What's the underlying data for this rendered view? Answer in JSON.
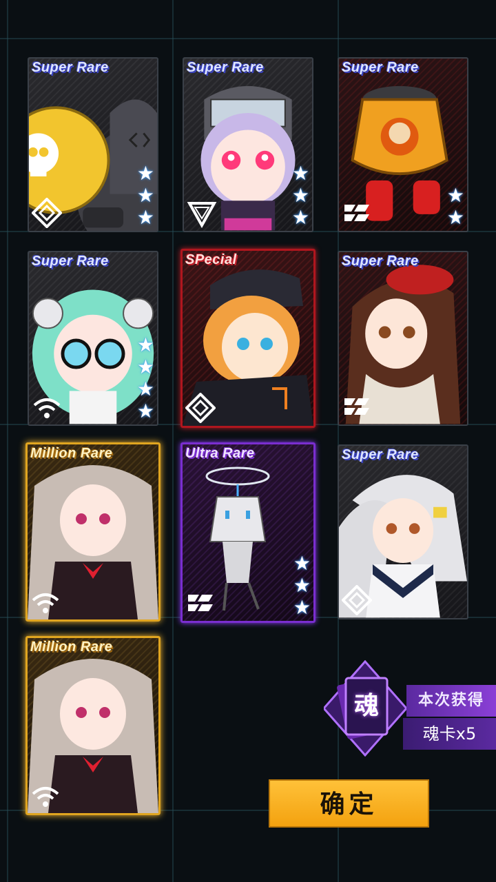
{
  "cards": [
    {
      "rarity": "Super Rare",
      "stars": 3,
      "faction": "diamond-faction-icon",
      "character": "yellow-skull-bomb-robot"
    },
    {
      "rarity": "Super Rare",
      "stars": 3,
      "faction": "triangle-faction-icon",
      "character": "purple-hair-visor-girl"
    },
    {
      "rarity": "Super Rare",
      "stars": 2,
      "faction": "slash-faction-icon",
      "character": "orange-skull-capsule-robot"
    },
    {
      "rarity": "Super Rare",
      "stars": 4,
      "faction": "wifi-faction-icon",
      "character": "green-hair-glasses-girl"
    },
    {
      "rarity": "SPecial",
      "stars": 0,
      "faction": "diamond-faction-icon",
      "character": "orange-hair-cap-girl"
    },
    {
      "rarity": "Super Rare",
      "stars": 0,
      "faction": "slash-faction-icon",
      "character": "brown-hair-beret-girl"
    },
    {
      "rarity": "Million Rare",
      "stars": 0,
      "faction": "wifi-faction-icon",
      "character": "silver-hair-maid-girl"
    },
    {
      "rarity": "Ultra Rare",
      "stars": 3,
      "faction": "slash-faction-icon",
      "character": "white-box-robot"
    },
    {
      "rarity": "Super Rare",
      "stars": 0,
      "faction": "diamond-faction-icon",
      "character": "white-hair-sailor-girl"
    },
    {
      "rarity": "Million Rare",
      "stars": 0,
      "faction": "wifi-faction-icon",
      "character": "silver-hair-maid-girl"
    }
  ],
  "reward": {
    "title": "本次获得",
    "badge_char": "魂",
    "item": "魂卡x5"
  },
  "confirm_label": "确定",
  "colors": {
    "super_rare": "#3a43c0",
    "special": "#c0202a",
    "ultra_rare": "#8e3cff",
    "million_rare": "#ffbf30",
    "confirm": "#f3a10e"
  }
}
